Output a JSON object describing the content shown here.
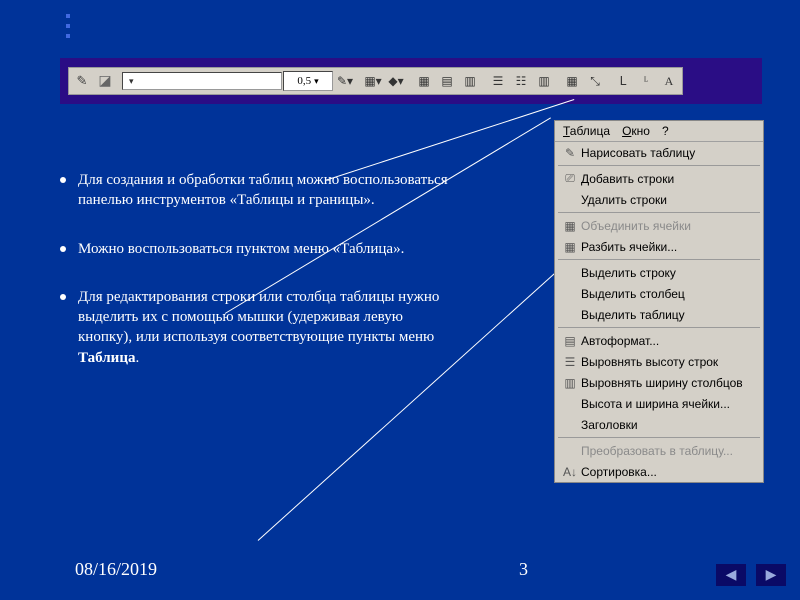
{
  "toolbar": {
    "line_width": "0,5"
  },
  "bullets": [
    "Для создания и обработки таблиц можно воспользоваться панелью инструментов «Таблицы и границы».",
    "Можно воспользоваться пунктом меню «Таблица».",
    "Для редактирования строки или столбца таблицы нужно выделить их с помощью мышки (удерживая левую кнопку), или используя соответствующие пункты меню Таблица."
  ],
  "menu": {
    "top": {
      "table": "Таблица",
      "window": "Окно",
      "help": "?"
    },
    "items": [
      {
        "text": "Нарисовать таблицу",
        "icon": "✎",
        "sec": 1
      },
      {
        "text": "Добавить строки",
        "icon": "⎚",
        "sec": 2
      },
      {
        "text": "Удалить строки",
        "icon": "",
        "sec": 2
      },
      {
        "text": "Объединить ячейки",
        "icon": "▦",
        "disabled": true,
        "sec": 3
      },
      {
        "text": "Разбить ячейки...",
        "icon": "▦",
        "sec": 3
      },
      {
        "text": "Выделить строку",
        "icon": "",
        "sec": 4
      },
      {
        "text": "Выделить столбец",
        "icon": "",
        "sec": 4
      },
      {
        "text": "Выделить таблицу",
        "icon": "",
        "sec": 4
      },
      {
        "text": "Автоформат...",
        "icon": "▤",
        "sec": 5
      },
      {
        "text": "Выровнять высоту строк",
        "icon": "☰",
        "sec": 5
      },
      {
        "text": "Выровнять ширину столбцов",
        "icon": "▥",
        "sec": 5
      },
      {
        "text": "Высота и ширина ячейки...",
        "icon": "",
        "sec": 5
      },
      {
        "text": "Заголовки",
        "icon": "",
        "sec": 5
      },
      {
        "text": "Преобразовать в таблицу...",
        "icon": "",
        "disabled": true,
        "sec": 6
      },
      {
        "text": "Сортировка...",
        "icon": "A↓",
        "sec": 6
      }
    ]
  },
  "footer": {
    "date": "08/16/2019",
    "page": "3"
  },
  "nav": {
    "prev": "◀",
    "next": "▶"
  }
}
